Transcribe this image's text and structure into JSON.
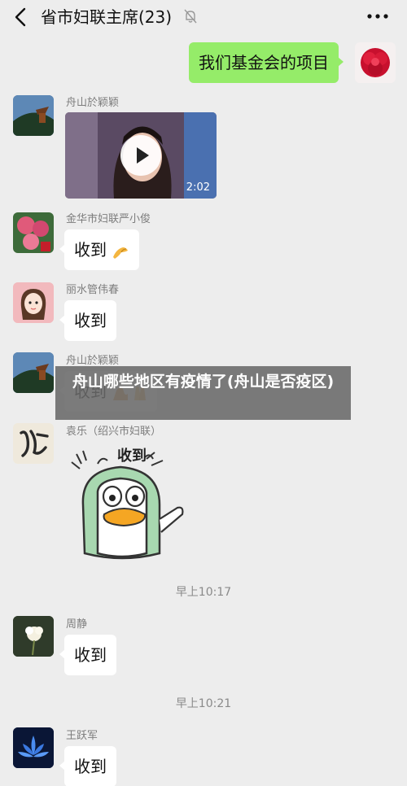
{
  "header": {
    "title": "省市妇联主席(23)",
    "back_icon": "chevron-left-icon",
    "mute_icon": "bell-off-icon",
    "more_icon": "more-dots-icon"
  },
  "messages": {
    "self_1": {
      "text": "我们基金会的项目"
    },
    "m1": {
      "name": "舟山於颖颖",
      "video_duration": "2:02"
    },
    "m2": {
      "name": "金华市妇联严小俊",
      "text": "收到",
      "emoji": "pinch-hand-emoji"
    },
    "m3": {
      "name": "丽水管伟春",
      "text": "收到"
    },
    "m4": {
      "name": "舟山於颖颖",
      "text": "收到",
      "emoji": "muscle-pray-emoji"
    },
    "m5": {
      "name": "袁乐（绍兴市妇联）",
      "sticker_text": "收到"
    },
    "time1": "早上10:17",
    "m6": {
      "name": "周静",
      "text": "收到"
    },
    "time2": "早上10:21",
    "m7": {
      "name": "王跃军",
      "text": "收到"
    }
  },
  "overlay": {
    "text": "舟山哪些地区有疫情了(舟山是否疫区)"
  },
  "colors": {
    "background": "#ededed",
    "self_bubble": "#95ec69",
    "other_bubble": "#ffffff",
    "overlay": "#696969"
  }
}
